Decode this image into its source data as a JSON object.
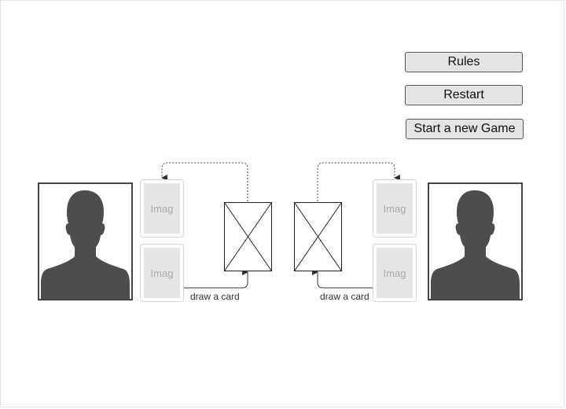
{
  "buttons": {
    "rules": "Rules",
    "restart": "Restart",
    "new_game": "Start a new Game"
  },
  "players": [
    {
      "avatar_icon": "person-silhouette-icon",
      "cards": [
        "Imag",
        "Imag"
      ],
      "draw_caption": "draw a card"
    },
    {
      "avatar_icon": "person-silhouette-icon",
      "cards": [
        "Imag",
        "Imag"
      ],
      "draw_caption": "draw a card"
    }
  ],
  "colors": {
    "button_bg": "#e4e4e4",
    "silhouette": "#4d4d4d",
    "placeholder": "#e6e6e6"
  }
}
